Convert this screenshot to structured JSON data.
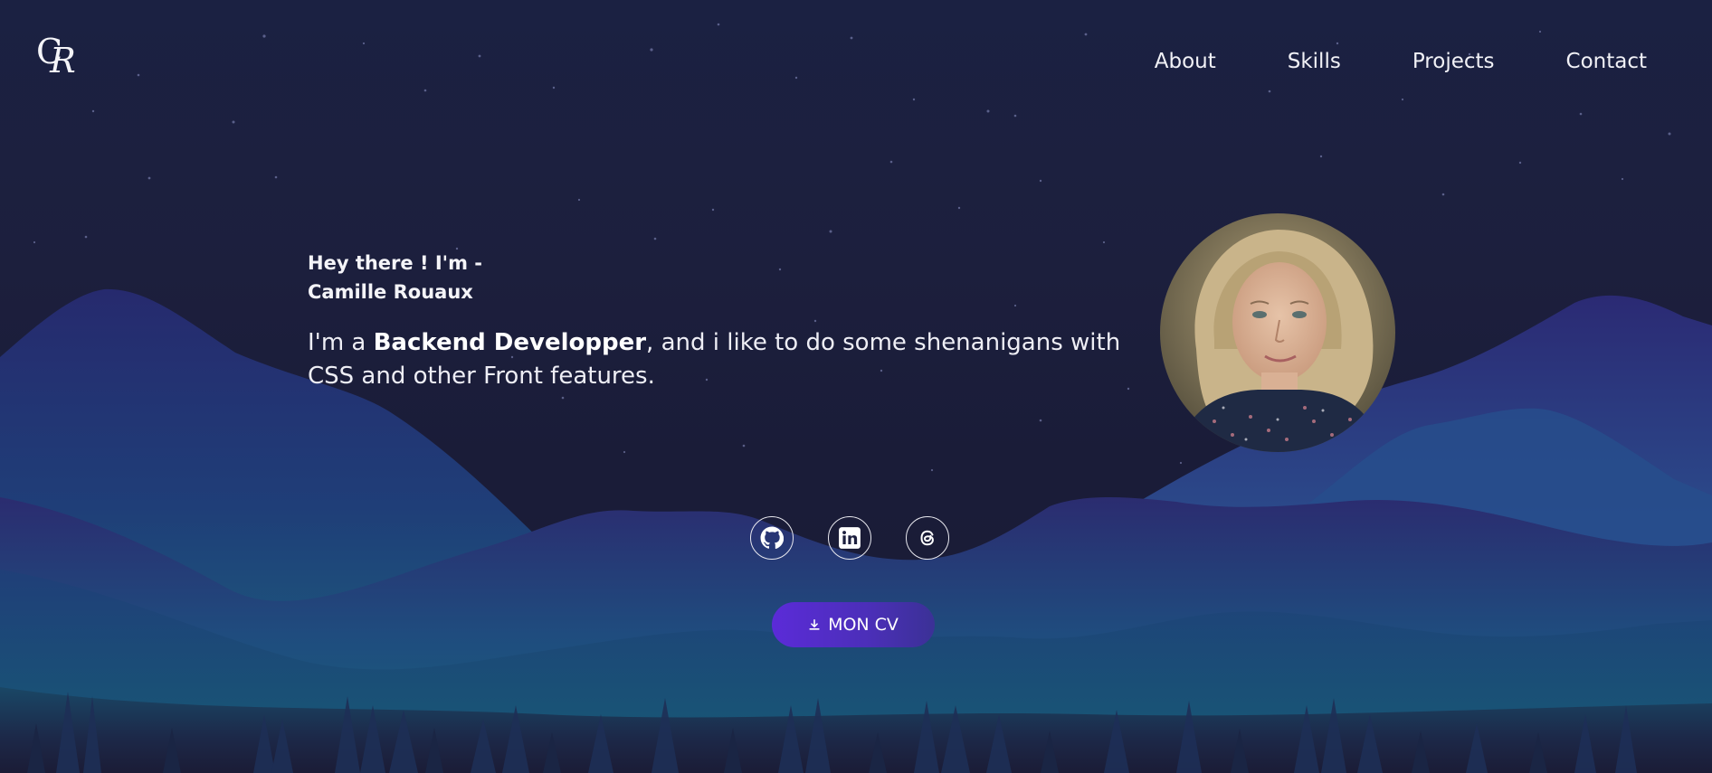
{
  "logo": {
    "letter_1": "C",
    "letter_2": "R"
  },
  "nav": {
    "items": [
      "About",
      "Skills",
      "Projects",
      "Contact"
    ]
  },
  "intro": {
    "greeting_line1": "Hey there ! I'm -",
    "greeting_line2": "Camille Rouaux",
    "desc_prefix": "I'm a ",
    "desc_bold": "Backend Developper",
    "desc_suffix": ", and i like to do some shenanigans with CSS and other Front features."
  },
  "socials": [
    {
      "icon": "github-icon"
    },
    {
      "icon": "linkedin-icon"
    },
    {
      "icon": "threads-icon"
    }
  ],
  "cv_button": {
    "label": "MON CV",
    "icon": "download-icon"
  },
  "colors": {
    "background": "#1c1f3e",
    "accent": "#5b2bd8",
    "mountain_far": "#2a2d6f",
    "mountain_teal": "#1b6a7d"
  }
}
